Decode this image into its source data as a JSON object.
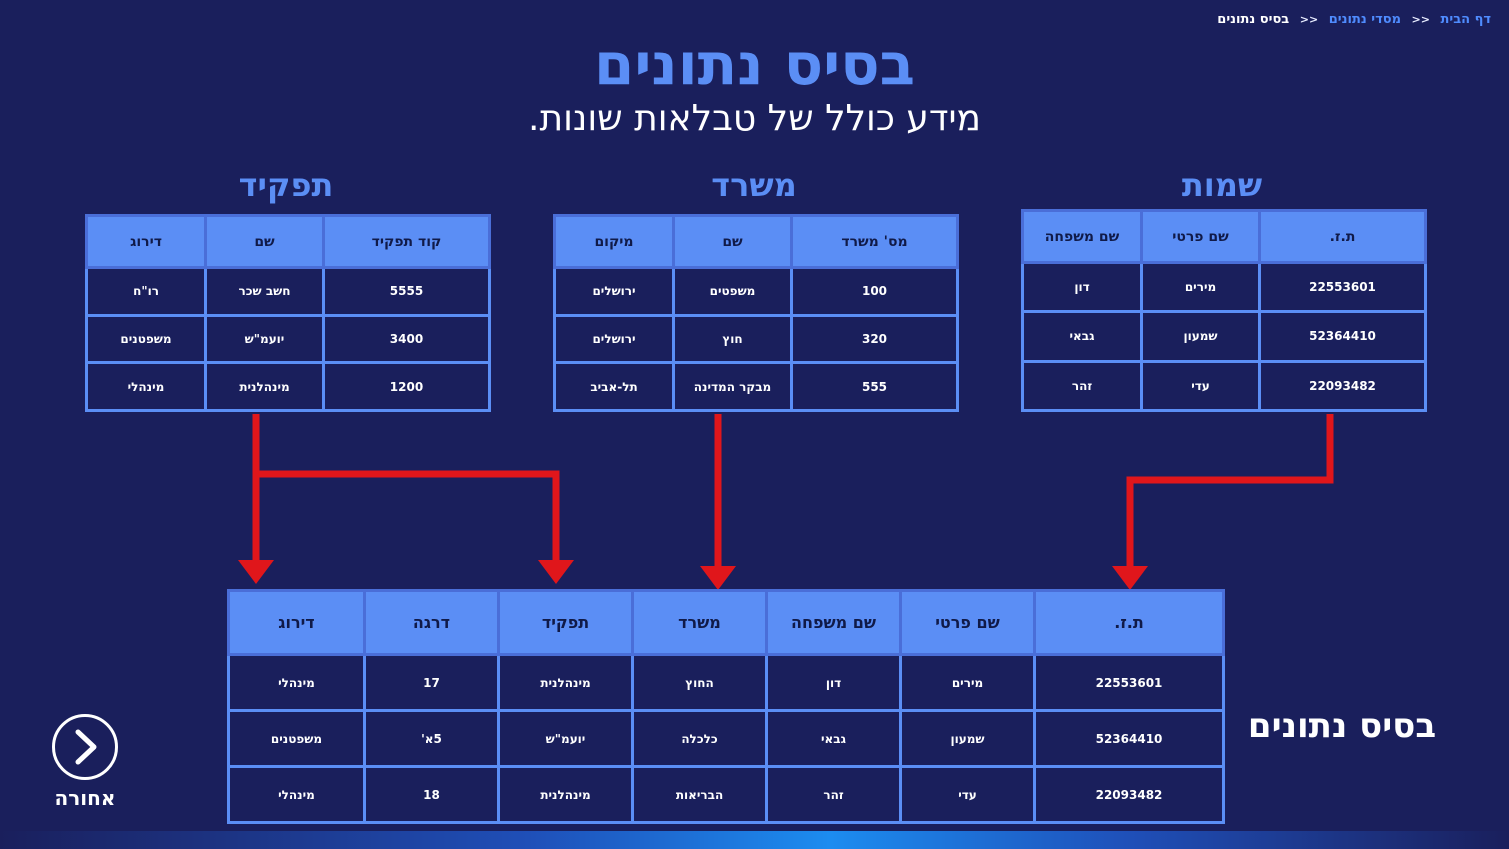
{
  "breadcrumb": {
    "home": "דף הבית",
    "section": "מסדי נתונים",
    "current": "בסיס נתונים",
    "separator": "<<"
  },
  "header": {
    "title": "בסיס נתונים",
    "subtitle": "מידע כולל של טבלאות שונות."
  },
  "tables": {
    "names": {
      "title": "שמות",
      "headers": [
        "ת.ז.",
        "שם פרטי",
        "שם משפחה"
      ],
      "rows": [
        [
          "22553601",
          "מירים",
          "דון"
        ],
        [
          "52364410",
          "שמעון",
          "גבאי"
        ],
        [
          "22093482",
          "עדי",
          "זהר"
        ]
      ]
    },
    "office": {
      "title": "משרד",
      "headers": [
        "מס' משרד",
        "שם",
        "מיקום"
      ],
      "rows": [
        [
          "100",
          "משפטים",
          "ירושלים"
        ],
        [
          "320",
          "חוץ",
          "ירושלים"
        ],
        [
          "555",
          "מבקר המדינה",
          "תל-אביב"
        ]
      ]
    },
    "role": {
      "title": "תפקיד",
      "headers": [
        "קוד תפקיד",
        "שם",
        "דירוג"
      ],
      "rows": [
        [
          "5555",
          "חשב שכר",
          "רו\"ח"
        ],
        [
          "3400",
          "יועמ\"ש",
          "משפטנים"
        ],
        [
          "1200",
          "מינהלנית",
          "מינהלי"
        ]
      ]
    },
    "database": {
      "label": "בסיס נתונים",
      "headers": [
        "ת.ז.",
        "שם פרטי",
        "שם משפחה",
        "משרד",
        "תפקיד",
        "דרגה",
        "דירוג"
      ],
      "rows": [
        [
          "22553601",
          "מירים",
          "דון",
          "החוץ",
          "מינהלנית",
          "17",
          "מינהלי"
        ],
        [
          "52364410",
          "שמעון",
          "גבאי",
          "כלכלה",
          "יועמ\"ש",
          "5א'",
          "משפטנים"
        ],
        [
          "22093482",
          "עדי",
          "זהר",
          "הבריאות",
          "מינהלנית",
          "18",
          "מינהלי"
        ]
      ]
    }
  },
  "navigation": {
    "back_label": "אחורה",
    "back_icon": "chevron-right-icon"
  },
  "colors": {
    "background": "#1a1f5c",
    "accent": "#5b8ef5",
    "arrow": "#e0161b"
  }
}
